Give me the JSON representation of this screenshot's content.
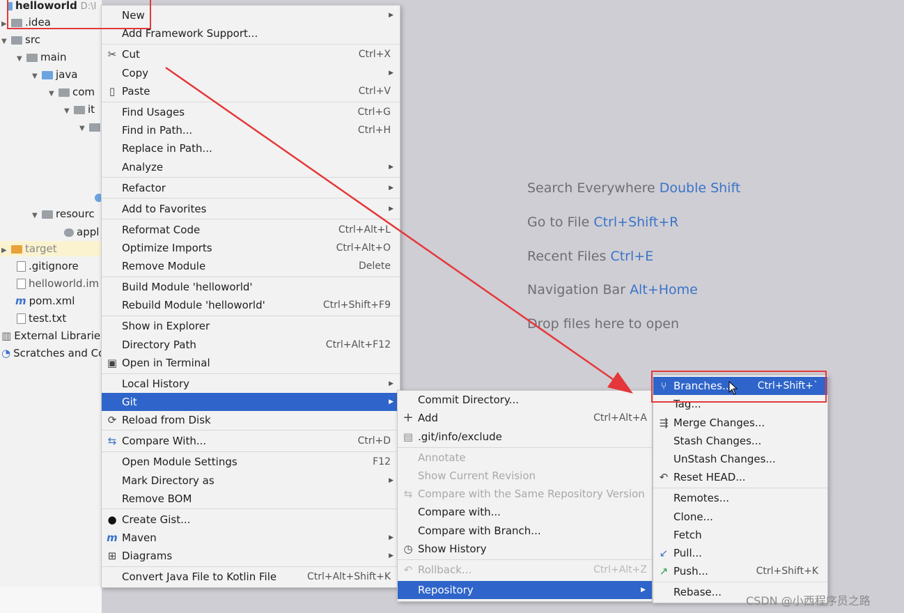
{
  "project_tree": {
    "root_label": "helloworld",
    "root_path": "D:\\I",
    "items": [
      {
        "label": ".idea",
        "icon": "folder-gray"
      },
      {
        "label": "src",
        "icon": "folder-gray"
      },
      {
        "label": "main",
        "icon": "folder-gray"
      },
      {
        "label": "java",
        "icon": "folder-blue"
      },
      {
        "label": "com",
        "icon": "package"
      },
      {
        "label": "it",
        "icon": "package"
      },
      {
        "label": "resourc",
        "icon": "folder-resources"
      },
      {
        "label": "appl",
        "icon": "config-file"
      },
      {
        "label": "target",
        "icon": "folder-orange"
      },
      {
        "label": ".gitignore",
        "icon": "file"
      },
      {
        "label": "helloworld.im",
        "icon": "file"
      },
      {
        "label": "pom.xml",
        "icon": "maven-m"
      },
      {
        "label": "test.txt",
        "icon": "file"
      },
      {
        "label": "External Libraries",
        "icon": "libraries"
      },
      {
        "label": "Scratches and Co",
        "icon": "scratches"
      }
    ]
  },
  "editor_hints": [
    {
      "text": "Search Everywhere",
      "key": "Double Shift"
    },
    {
      "text": "Go to File",
      "key": "Ctrl+Shift+R"
    },
    {
      "text": "Recent Files",
      "key": "Ctrl+E"
    },
    {
      "text": "Navigation Bar",
      "key": "Alt+Home"
    },
    {
      "text": "Drop files here to open",
      "key": ""
    }
  ],
  "context_menu": {
    "items": [
      {
        "label": "New",
        "shortcut": "",
        "submenu": true
      },
      {
        "label": "Add Framework Support...",
        "shortcut": ""
      },
      {
        "label": "Cut",
        "shortcut": "Ctrl+X",
        "icon": "scissors"
      },
      {
        "label": "Copy",
        "shortcut": "",
        "submenu": true
      },
      {
        "label": "Paste",
        "shortcut": "Ctrl+V",
        "icon": "clipboard"
      },
      {
        "label": "Find Usages",
        "shortcut": "Ctrl+G"
      },
      {
        "label": "Find in Path...",
        "shortcut": "Ctrl+H"
      },
      {
        "label": "Replace in Path...",
        "shortcut": ""
      },
      {
        "label": "Analyze",
        "shortcut": "",
        "submenu": true
      },
      {
        "label": "Refactor",
        "shortcut": "",
        "submenu": true
      },
      {
        "label": "Add to Favorites",
        "shortcut": "",
        "submenu": true
      },
      {
        "label": "Reformat Code",
        "shortcut": "Ctrl+Alt+L"
      },
      {
        "label": "Optimize Imports",
        "shortcut": "Ctrl+Alt+O"
      },
      {
        "label": "Remove Module",
        "shortcut": "Delete"
      },
      {
        "label": "Build Module 'helloworld'",
        "shortcut": ""
      },
      {
        "label": "Rebuild Module 'helloworld'",
        "shortcut": "Ctrl+Shift+F9"
      },
      {
        "label": "Show in Explorer",
        "shortcut": ""
      },
      {
        "label": "Directory Path",
        "shortcut": "Ctrl+Alt+F12"
      },
      {
        "label": "Open in Terminal",
        "shortcut": "",
        "icon": "terminal"
      },
      {
        "label": "Local History",
        "shortcut": "",
        "submenu": true
      },
      {
        "label": "Git",
        "shortcut": "",
        "submenu": true,
        "selected": true
      },
      {
        "label": "Reload from Disk",
        "shortcut": "",
        "icon": "reload"
      },
      {
        "label": "Compare With...",
        "shortcut": "Ctrl+D",
        "icon": "compare-arrows"
      },
      {
        "label": "Open Module Settings",
        "shortcut": "F12"
      },
      {
        "label": "Mark Directory as",
        "shortcut": "",
        "submenu": true
      },
      {
        "label": "Remove BOM",
        "shortcut": ""
      },
      {
        "label": "Create Gist...",
        "shortcut": "",
        "icon": "github"
      },
      {
        "label": "Maven",
        "shortcut": "",
        "submenu": true,
        "icon": "maven-m"
      },
      {
        "label": "Diagrams",
        "shortcut": "",
        "submenu": true,
        "icon": "diagram"
      },
      {
        "label": "Convert Java File to Kotlin File",
        "shortcut": "Ctrl+Alt+Shift+K"
      }
    ]
  },
  "git_menu": {
    "items": [
      {
        "label": "Commit Directory...",
        "shortcut": ""
      },
      {
        "label": "Add",
        "shortcut": "Ctrl+Alt+A",
        "icon": "plus"
      },
      {
        "label": ".git/info/exclude",
        "shortcut": "",
        "icon": "file"
      },
      {
        "label": "Annotate",
        "shortcut": "",
        "disabled": true
      },
      {
        "label": "Show Current Revision",
        "shortcut": "",
        "disabled": true
      },
      {
        "label": "Compare with the Same Repository Version",
        "shortcut": "",
        "disabled": true,
        "icon": "compare-arrows"
      },
      {
        "label": "Compare with...",
        "shortcut": ""
      },
      {
        "label": "Compare with Branch...",
        "shortcut": ""
      },
      {
        "label": "Show History",
        "shortcut": "",
        "icon": "clock"
      },
      {
        "label": "Rollback...",
        "shortcut": "Ctrl+Alt+Z",
        "disabled": true,
        "icon": "undo"
      },
      {
        "label": "Repository",
        "shortcut": "",
        "submenu": true,
        "selected": true
      }
    ]
  },
  "repository_menu": {
    "items": [
      {
        "label": "Branches...",
        "shortcut": "Ctrl+Shift+`",
        "selected": true,
        "icon": "branch"
      },
      {
        "label": "Tag...",
        "shortcut": ""
      },
      {
        "label": "Merge Changes...",
        "shortcut": "",
        "icon": "merge"
      },
      {
        "label": "Stash Changes...",
        "shortcut": ""
      },
      {
        "label": "UnStash Changes...",
        "shortcut": ""
      },
      {
        "label": "Reset HEAD...",
        "shortcut": "",
        "icon": "undo"
      },
      {
        "label": "Remotes...",
        "shortcut": ""
      },
      {
        "label": "Clone...",
        "shortcut": ""
      },
      {
        "label": "Fetch",
        "shortcut": ""
      },
      {
        "label": "Pull...",
        "shortcut": "",
        "icon": "pull-arrow"
      },
      {
        "label": "Push...",
        "shortcut": "Ctrl+Shift+K",
        "icon": "push-arrow"
      },
      {
        "label": "Rebase...",
        "shortcut": ""
      }
    ]
  },
  "watermark": "CSDN @小西程序员之路",
  "colors": {
    "selection": "#2f65ca",
    "annotation_red": "#e5373a",
    "hint_key": "#3a73c9",
    "menu_bg": "#f2f2f2"
  }
}
